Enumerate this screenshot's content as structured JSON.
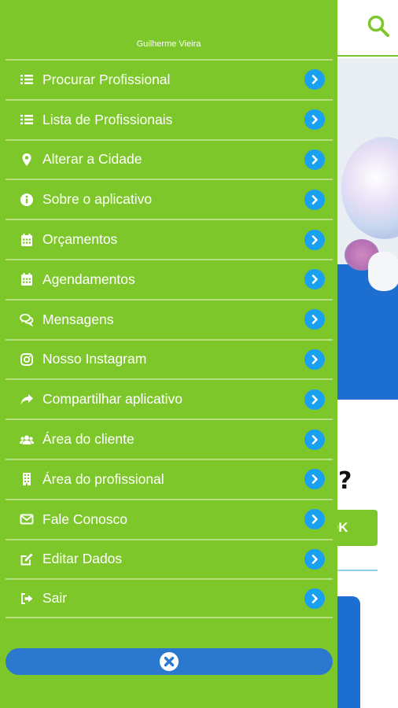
{
  "drawer": {
    "user_name": "Guilherme Vieira",
    "items": [
      {
        "label": "Procurar Profissional",
        "icon": "list-icon"
      },
      {
        "label": "Lista de Profissionais",
        "icon": "list-icon"
      },
      {
        "label": "Alterar a Cidade",
        "icon": "map-marker-icon"
      },
      {
        "label": "Sobre o aplicativo",
        "icon": "info-icon"
      },
      {
        "label": "Orçamentos",
        "icon": "calendar-icon"
      },
      {
        "label": "Agendamentos",
        "icon": "calendar-icon"
      },
      {
        "label": "Mensagens",
        "icon": "chat-icon"
      },
      {
        "label": "Nosso Instagram",
        "icon": "instagram-icon"
      },
      {
        "label": "Compartilhar aplicativo",
        "icon": "share-icon"
      },
      {
        "label": "Área do cliente",
        "icon": "users-icon"
      },
      {
        "label": "Área do profissional",
        "icon": "building-icon"
      },
      {
        "label": "Fale Conosco",
        "icon": "envelope-icon"
      },
      {
        "label": "Editar Dados",
        "icon": "edit-icon"
      },
      {
        "label": "Sair",
        "icon": "sign-out-icon"
      }
    ]
  },
  "background": {
    "question_mark": "?",
    "ok_button": "OK"
  },
  "colors": {
    "drawer_green": "#7ec72a",
    "arrow_blue": "#1aa0f0",
    "close_blue": "#2b78cf",
    "hero_blue": "#1c6ed1"
  }
}
